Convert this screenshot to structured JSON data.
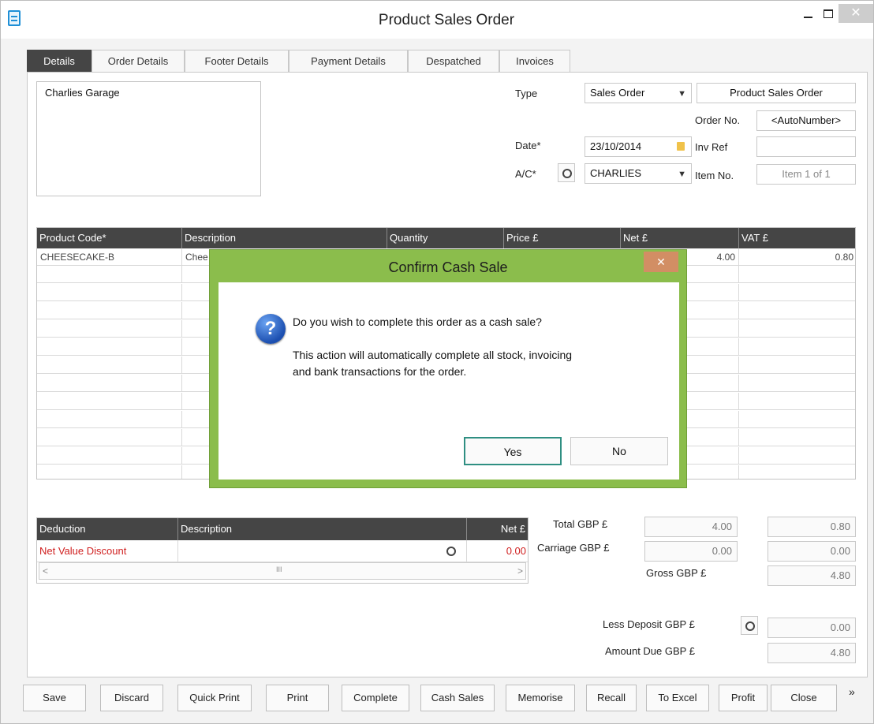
{
  "window": {
    "title": "Product Sales Order",
    "min_glyph": "",
    "close_glyph": "✕"
  },
  "tabs": [
    "Details",
    "Order Details",
    "Footer Details",
    "Payment Details",
    "Despatched",
    "Invoices"
  ],
  "customer": {
    "address": "Charlies Garage"
  },
  "header_fields": {
    "type_label": "Type",
    "type_value": "Sales Order",
    "order_type_display": "Product Sales Order",
    "order_no_label": "Order No.",
    "order_no_value": "<AutoNumber>",
    "date_label": "Date*",
    "date_value": "23/10/2014",
    "inv_ref_label": "Inv Ref",
    "inv_ref_value": "",
    "ac_label": "A/C*",
    "ac_value": "CHARLIES",
    "item_no_label": "Item No.",
    "item_no_value": "Item 1 of 1"
  },
  "product_grid": {
    "columns": [
      "Product Code*",
      "Description",
      "Quantity",
      "Price £",
      "Net £",
      "VAT £"
    ],
    "rows": [
      {
        "code": "CHEESECAKE-B",
        "description": "Chee",
        "net": "4.00",
        "vat": "0.80"
      }
    ]
  },
  "dialog": {
    "title": "Confirm Cash Sale",
    "close_glyph": "✕",
    "question": "Do you wish to complete this order as a cash sale?",
    "detail_line1": "This action will automatically complete all stock, invoicing",
    "detail_line2": "and bank transactions for the order.",
    "yes_label": "Yes",
    "no_label": "No"
  },
  "deductions": {
    "columns": [
      "Deduction",
      "Description",
      "Net £"
    ],
    "rows": [
      {
        "deduction": "Net Value Discount",
        "description": "",
        "net": "0.00"
      }
    ],
    "scroll_left": "<",
    "scroll_mid": "III",
    "scroll_right": ">"
  },
  "totals": {
    "total_label": "Total GBP £",
    "total_net": "4.00",
    "total_vat": "0.80",
    "carriage_label": "Carriage GBP £",
    "carriage_net": "0.00",
    "carriage_vat": "0.00",
    "gross_label": "Gross GBP £",
    "gross_value": "4.80",
    "deposit_label": "Less Deposit GBP £",
    "deposit_value": "0.00",
    "amount_due_label": "Amount Due GBP £",
    "amount_due_value": "4.80"
  },
  "buttons": [
    "Save",
    "Discard",
    "Quick Print",
    "Print",
    "Complete",
    "Cash Sales",
    "Memorise",
    "Recall",
    "To Excel",
    "Profit",
    "Close"
  ],
  "more_glyph": "»"
}
